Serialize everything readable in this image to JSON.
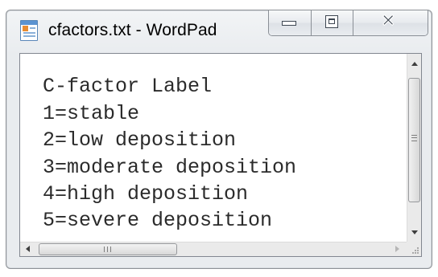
{
  "window": {
    "title": "cfactors.txt - WordPad",
    "app_icon": "wordpad-icon",
    "caption_buttons": {
      "minimize_icon": "minimize-icon",
      "maximize_icon": "maximize-icon",
      "close_icon": "close-icon",
      "close_glyph": "✕"
    }
  },
  "document": {
    "lines": [
      "C-factor Label",
      "1=stable",
      "2=low deposition",
      "3=moderate deposition",
      "4=high deposition",
      "5=severe deposition"
    ]
  },
  "scrollbars": {
    "vertical": {
      "up_icon": "arrow-up-icon",
      "down_icon": "arrow-down-icon",
      "grip_icon": "grip-icon"
    },
    "horizontal": {
      "left_icon": "arrow-left-icon",
      "right_icon": "arrow-right-icon",
      "grip_icon": "grip-icon"
    }
  },
  "colors": {
    "text": "#2b2b2b",
    "window_border": "#8d9196",
    "accent": "#5b93d1"
  }
}
